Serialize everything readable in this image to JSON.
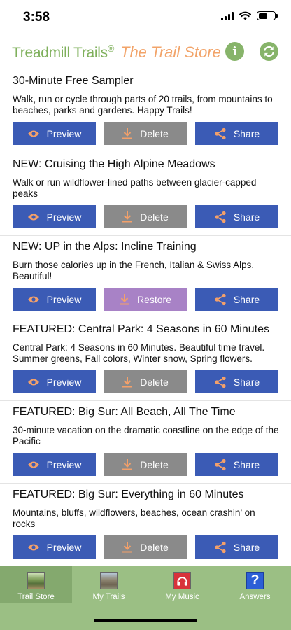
{
  "status": {
    "time": "3:58"
  },
  "header": {
    "brand": "Treadmill Trails",
    "brand_mark": "®",
    "store": "The Trail Store",
    "info_glyph": "i"
  },
  "buttons": {
    "preview": "Preview",
    "delete": "Delete",
    "restore": "Restore",
    "share": "Share"
  },
  "items": [
    {
      "title": "30-Minute Free Sampler",
      "desc": "Walk, run or cycle through parts of 20 trails, from mountains to beaches, parks and gardens. Happy Trails!",
      "action": "Delete"
    },
    {
      "title": "NEW: Cruising the High Alpine Meadows",
      "desc": "Walk or run wildflower-lined paths between glacier-capped peaks",
      "action": "Delete"
    },
    {
      "title": "NEW: UP in the Alps: Incline Training",
      "desc": "Burn those calories up in the French, Italian & Swiss Alps. Beautiful!",
      "action": "Restore"
    },
    {
      "title": "FEATURED: Central Park: 4 Seasons in 60 Minutes",
      "desc": "Central Park: 4 Seasons in 60 Minutes. Beautiful time travel. Summer greens, Fall colors, Winter snow, Spring flowers.",
      "action": "Delete"
    },
    {
      "title": "FEATURED: Big Sur: All Beach, All The Time",
      "desc": "30-minute vacation on the dramatic coastline on the edge of the Pacific",
      "action": "Delete"
    },
    {
      "title": "FEATURED: Big Sur: Everything in 60 Minutes",
      "desc": "Mountains, bluffs, wildflowers, beaches, ocean crashin’ on rocks",
      "action": "Delete"
    }
  ],
  "tabs": [
    {
      "label": "Trail Store",
      "icon": "trail-store-icon"
    },
    {
      "label": "My Trails",
      "icon": "my-trails-icon"
    },
    {
      "label": "My Music",
      "icon": "headphones-icon"
    },
    {
      "label": "Answers",
      "icon": "question-icon",
      "glyph": "?"
    }
  ],
  "colors": {
    "brand_green": "#7fb05c",
    "store_orange": "#f2a46a",
    "button_blue": "#3b5bb5",
    "button_gray": "#8a8a8a",
    "button_purple": "#a882c6",
    "tabbar_green": "#9bbf84"
  }
}
